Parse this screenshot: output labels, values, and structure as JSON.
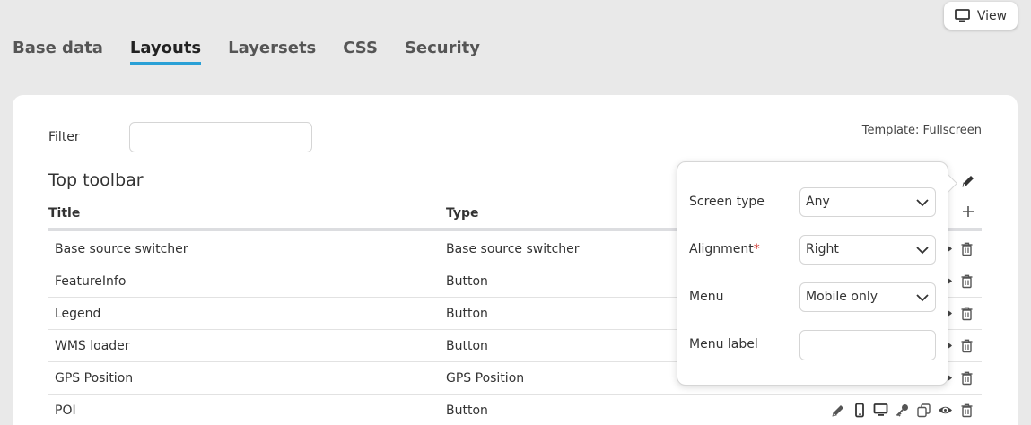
{
  "header": {
    "view_label": "View"
  },
  "tabs": [
    {
      "label": "Base data",
      "active": false
    },
    {
      "label": "Layouts",
      "active": true
    },
    {
      "label": "Layersets",
      "active": false
    },
    {
      "label": "CSS",
      "active": false
    },
    {
      "label": "Security",
      "active": false
    }
  ],
  "filter": {
    "label": "Filter",
    "value": ""
  },
  "template_label": "Template: Fullscreen",
  "section": {
    "title": "Top toolbar"
  },
  "table": {
    "columns": [
      "Title",
      "Type"
    ],
    "rows": [
      {
        "title": "Base source switcher",
        "type": "Base source switcher"
      },
      {
        "title": "FeatureInfo",
        "type": "Button"
      },
      {
        "title": "Legend",
        "type": "Button"
      },
      {
        "title": "WMS loader",
        "type": "Button"
      },
      {
        "title": "GPS Position",
        "type": "GPS Position"
      },
      {
        "title": "POI",
        "type": "Button"
      }
    ],
    "row_actions": [
      "edit-icon",
      "mobile-icon",
      "desktop-icon",
      "key-icon",
      "copy-icon",
      "eye-icon",
      "trash-icon"
    ]
  },
  "popover": {
    "screen_type": {
      "label": "Screen type",
      "value": "Any"
    },
    "alignment": {
      "label": "Alignment",
      "required_mark": "*",
      "value": "Right"
    },
    "menu": {
      "label": "Menu",
      "value": "Mobile only"
    },
    "menu_label": {
      "label": "Menu label",
      "value": ""
    }
  },
  "colors": {
    "accent": "#2aa0d6",
    "required": "#d0342c",
    "background": "#e9e9e9"
  }
}
